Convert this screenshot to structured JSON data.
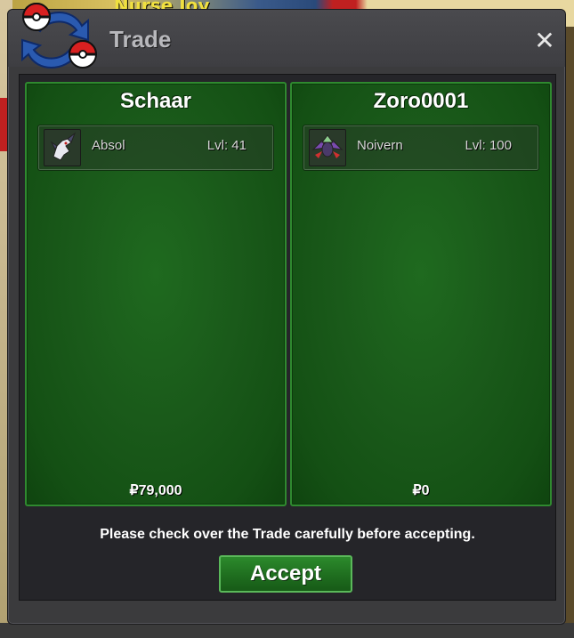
{
  "background": {
    "npc_label": "Nurse Joy"
  },
  "window": {
    "title": "Trade",
    "close_label": "✕",
    "logo_icon": "trade-pokeball-arrows-icon"
  },
  "trade": {
    "left": {
      "player_name": "Schaar",
      "pokemon": [
        {
          "name": "Absol",
          "level": "Lvl: 41",
          "icon": "absol-sprite-icon"
        }
      ],
      "money": "₽79,000"
    },
    "right": {
      "player_name": "Zoro0001",
      "pokemon": [
        {
          "name": "Noivern",
          "level": "Lvl: 100",
          "icon": "noivern-sprite-icon"
        }
      ],
      "money": "₽0"
    }
  },
  "notice": "Please check over the Trade carefully before accepting.",
  "accept_label": "Accept",
  "colors": {
    "panel_green": "#1a5a1a",
    "panel_border": "#2f8a2f",
    "window_bg": "#3b3b3d",
    "accept_green": "#1f6e1f"
  }
}
